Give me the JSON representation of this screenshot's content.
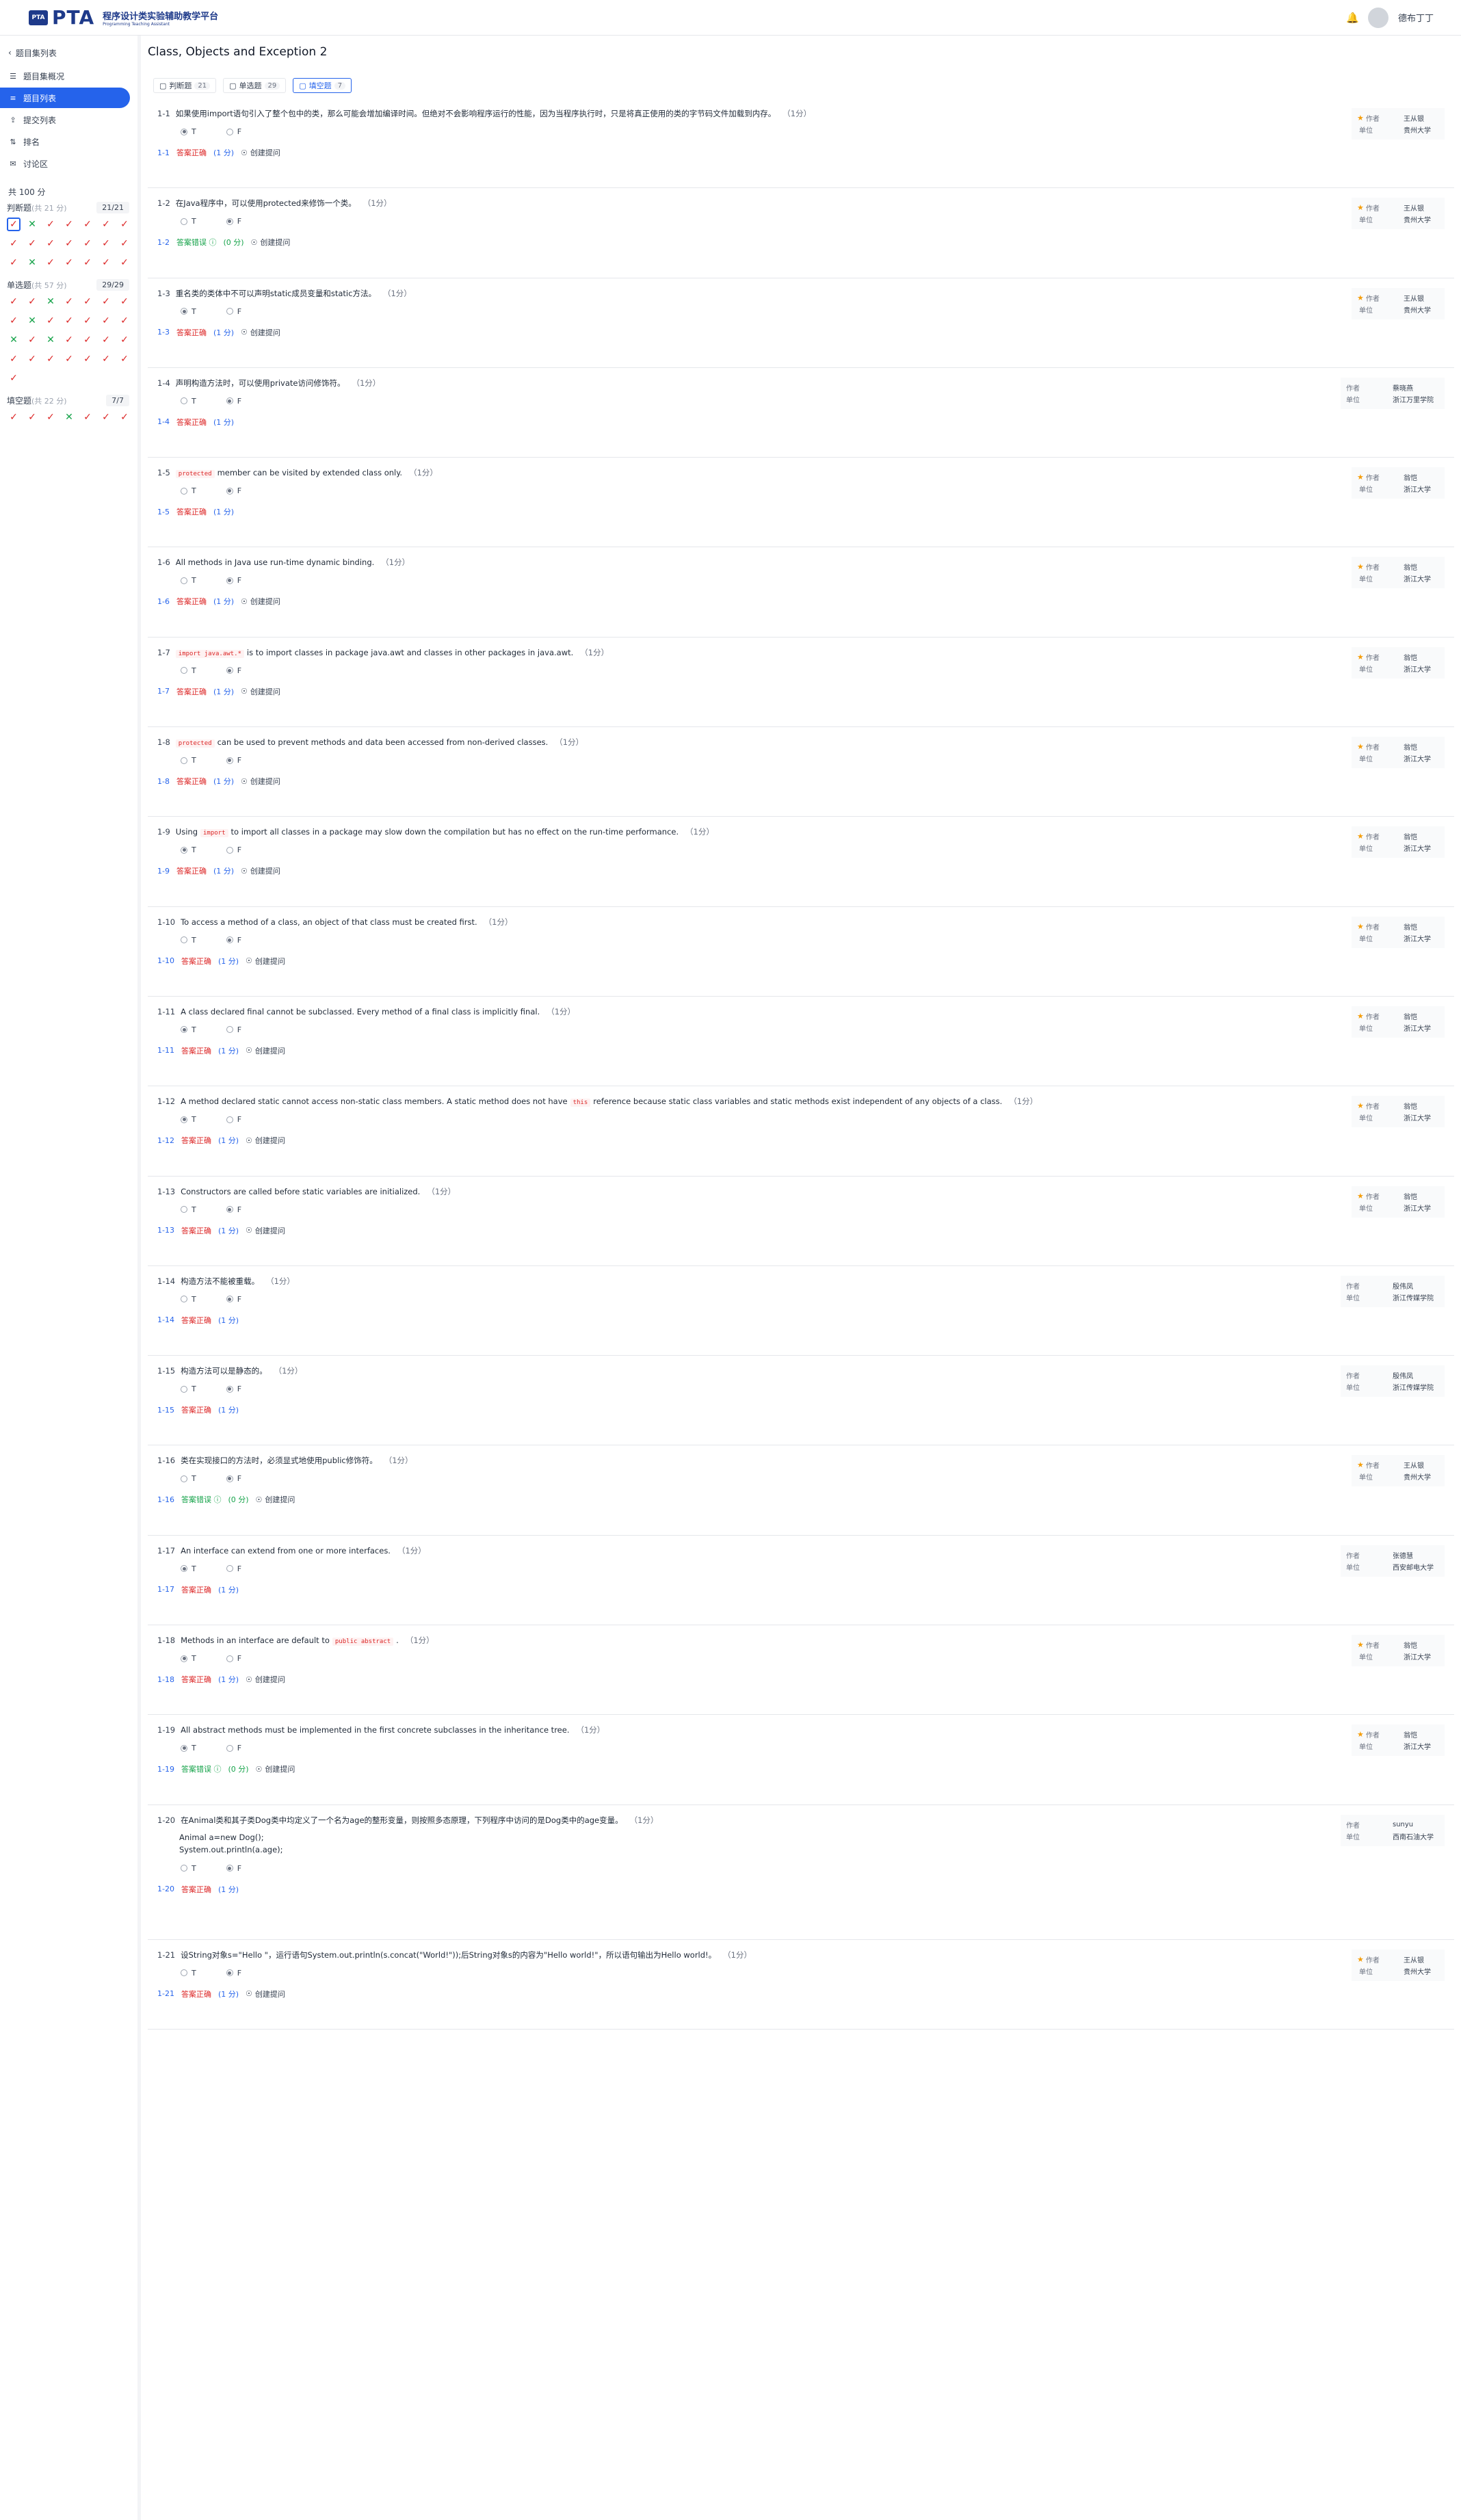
{
  "header": {
    "logo_badge": "PTA",
    "logo_text": "PTA",
    "platform_title": "程序设计类实验辅助教学平台",
    "platform_en": "Programming Teaching Assistant",
    "username": "德布丁丁"
  },
  "sidebar": {
    "back": "题目集列表",
    "nav": [
      {
        "label": "题目集概况",
        "icon": "book-icon"
      },
      {
        "label": "题目列表",
        "icon": "list-icon",
        "active": true
      },
      {
        "label": "提交列表",
        "icon": "upload-icon"
      },
      {
        "label": "排名",
        "icon": "sort-icon"
      },
      {
        "label": "讨论区",
        "icon": "chat-icon"
      }
    ],
    "total_score": "共 100 分",
    "sections": [
      {
        "name": "判断题",
        "sub": "(共 21 分)",
        "count": "21/21",
        "cells": [
          "c",
          "n",
          "o",
          "o",
          "o",
          "o",
          "o",
          "o",
          "o",
          "o",
          "o",
          "o",
          "o",
          "o",
          "o",
          "n",
          "o",
          "o",
          "o",
          "o",
          "o"
        ]
      },
      {
        "name": "单选题",
        "sub": "(共 57 分)",
        "count": "29/29",
        "cells": [
          "o",
          "o",
          "n",
          "o",
          "o",
          "o",
          "o",
          "o",
          "n",
          "o",
          "o",
          "o",
          "o",
          "o",
          "n",
          "o",
          "n",
          "o",
          "o",
          "o",
          "o",
          "o",
          "o",
          "o",
          "o",
          "o",
          "o",
          "o",
          "o"
        ]
      },
      {
        "name": "填空题",
        "sub": "(共 22 分)",
        "count": "7/7",
        "cells": [
          "o",
          "o",
          "o",
          "n",
          "o",
          "o",
          "o"
        ]
      }
    ]
  },
  "main": {
    "title": "Class, Objects and Exception 2",
    "tabs": [
      {
        "label": "判断题",
        "count": "21",
        "active": false
      },
      {
        "label": "单选题",
        "count": "29",
        "active": false
      },
      {
        "label": "填空题",
        "count": "7",
        "active": true
      }
    ],
    "author_label": "作者",
    "unit_label": "单位",
    "ask_label": "创建提问",
    "problems": [
      {
        "num": "1-1",
        "text": "如果使用import语句引入了整个包中的类，那么可能会增加编译时间。但绝对不会影响程序运行的性能，因为当程序执行时，只是将真正使用的类的字节码文件加载到内存。",
        "pts": "（1分）",
        "sel": "T",
        "status": "答案正确",
        "ok": false,
        "score": "(1 分)",
        "author": "王从银",
        "unit": "贵州大学",
        "ask": true
      },
      {
        "num": "1-2",
        "text": "在Java程序中，可以使用protected来修饰一个类。",
        "pts": "（1分）",
        "sel": "F",
        "status": "答案错误",
        "ok": true,
        "score": "(0 分)",
        "author": "王从银",
        "unit": "贵州大学",
        "ask": true
      },
      {
        "num": "1-3",
        "text": "重名类的类体中不可以声明static成员变量和static方法。",
        "pts": "（1分）",
        "sel": "T",
        "status": "答案正确",
        "ok": false,
        "score": "(1 分)",
        "author": "王从银",
        "unit": "贵州大学",
        "ask": true
      },
      {
        "num": "1-4",
        "text": "声明构造方法时，可以使用private访问修饰符。",
        "pts": "（1分）",
        "sel": "F",
        "status": "答案正确",
        "ok": false,
        "score": "(1 分)",
        "author": "蔡晓燕",
        "unit": "浙江万里学院",
        "ask": false,
        "wide": true
      },
      {
        "num": "1-5",
        "code": "protected",
        "text": "member can be visited by extended class only.",
        "pts": "（1分）",
        "sel": "F",
        "status": "答案正确",
        "ok": false,
        "score": "(1 分)",
        "author": "翁恺",
        "unit": "浙江大学",
        "ask": false
      },
      {
        "num": "1-6",
        "text": "All methods in Java use run-time dynamic binding.",
        "pts": "（1分）",
        "sel": "F",
        "status": "答案正确",
        "ok": false,
        "score": "(1 分)",
        "author": "翁恺",
        "unit": "浙江大学",
        "ask": true
      },
      {
        "num": "1-7",
        "code": "import java.awt.*",
        "text": "is to import classes in package java.awt and classes in other packages in java.awt.",
        "pts": "（1分）",
        "sel": "F",
        "status": "答案正确",
        "ok": false,
        "score": "(1 分)",
        "author": "翁恺",
        "unit": "浙江大学",
        "ask": true
      },
      {
        "num": "1-8",
        "code": "protected",
        "text": "can be used to prevent methods and data been accessed from non-derived classes.",
        "pts": "（1分）",
        "sel": "F",
        "status": "答案正确",
        "ok": false,
        "score": "(1 分)",
        "author": "翁恺",
        "unit": "浙江大学",
        "ask": true
      },
      {
        "num": "1-9",
        "pre": "Using",
        "code": "import",
        "text": "to import all classes in a package may slow down the compilation but has no effect on the run-time performance.",
        "pts": "（1分）",
        "sel": "T",
        "status": "答案正确",
        "ok": false,
        "score": "(1 分)",
        "author": "翁恺",
        "unit": "浙江大学",
        "ask": true
      },
      {
        "num": "1-10",
        "text": "To access a method of a class, an object of that class must be created first.",
        "pts": "（1分）",
        "sel": "F",
        "status": "答案正确",
        "ok": false,
        "score": "(1 分)",
        "author": "翁恺",
        "unit": "浙江大学",
        "ask": true
      },
      {
        "num": "1-11",
        "text": "A class declared final cannot be subclassed. Every method of a final class is implicitly final.",
        "pts": "（1分）",
        "sel": "T",
        "status": "答案正确",
        "ok": false,
        "score": "(1 分)",
        "author": "翁恺",
        "unit": "浙江大学",
        "ask": true
      },
      {
        "num": "1-12",
        "text": "A method declared static cannot access non-static class members. A static method does not have",
        "code2": "this",
        "text2": "reference because static class variables and static methods exist independent of any objects of a class.",
        "pts": "（1分）",
        "sel": "T",
        "status": "答案正确",
        "ok": false,
        "score": "(1 分)",
        "author": "翁恺",
        "unit": "浙江大学",
        "ask": true
      },
      {
        "num": "1-13",
        "text": "Constructors are called before static variables are initialized.",
        "pts": "（1分）",
        "sel": "F",
        "status": "答案正确",
        "ok": false,
        "score": "(1 分)",
        "author": "翁恺",
        "unit": "浙江大学",
        "ask": true
      },
      {
        "num": "1-14",
        "text": "构造方法不能被重载。",
        "pts": "（1分）",
        "sel": "F",
        "status": "答案正确",
        "ok": false,
        "score": "(1 分)",
        "author": "殷伟凤",
        "unit": "浙江传媒学院",
        "ask": false,
        "wide": true
      },
      {
        "num": "1-15",
        "text": "构造方法可以是静态的。",
        "pts": "（1分）",
        "sel": "F",
        "status": "答案正确",
        "ok": false,
        "score": "(1 分)",
        "author": "殷伟凤",
        "unit": "浙江传媒学院",
        "ask": false,
        "wide": true
      },
      {
        "num": "1-16",
        "text": "类在实现接口的方法时，必须显式地使用public修饰符。",
        "pts": "（1分）",
        "sel": "F",
        "status": "答案错误",
        "ok": true,
        "score": "(0 分)",
        "author": "王从银",
        "unit": "贵州大学",
        "ask": true
      },
      {
        "num": "1-17",
        "text": "An interface can extend from one or more interfaces.",
        "pts": "（1分）",
        "sel": "T",
        "status": "答案正确",
        "ok": false,
        "score": "(1 分)",
        "author": "张德慧",
        "unit": "西安邮电大学",
        "ask": false,
        "wide": true
      },
      {
        "num": "1-18",
        "pre": "Methods in an interface are default to",
        "code": "public abstract",
        "text": ".",
        "pts": "（1分）",
        "sel": "T",
        "status": "答案正确",
        "ok": false,
        "score": "(1 分)",
        "author": "翁恺",
        "unit": "浙江大学",
        "ask": true
      },
      {
        "num": "1-19",
        "text": "All abstract methods must be implemented in the first concrete subclasses in the inheritance tree.",
        "pts": "（1分）",
        "sel": "T",
        "status": "答案错误",
        "ok": true,
        "score": "(0 分)",
        "author": "翁恺",
        "unit": "浙江大学",
        "ask": true
      },
      {
        "num": "1-20",
        "text": "在Animal类和其子类Dog类中均定义了一个名为age的整形变量，则按照多态原理，下列程序中访问的是Dog类中的age变量。",
        "pts": "（1分）",
        "extra": [
          "Animal a=new Dog();",
          "System.out.println(a.age);"
        ],
        "sel": "F",
        "status": "答案正确",
        "ok": false,
        "score": "(1 分)",
        "author": "sunyu",
        "unit": "西南石油大学",
        "ask": false,
        "wide": true,
        "tall": true
      },
      {
        "num": "1-21",
        "text": "设String对象s=\"Hello \"，运行语句System.out.println(s.concat(\"World!\"));后String对象s的内容为\"Hello world!\"，所以语句输出为Hello world!。",
        "pts": "（1分）",
        "sel": "F",
        "status": "答案正确",
        "ok": false,
        "score": "(1 分)",
        "author": "王从银",
        "unit": "贵州大学",
        "ask": true
      }
    ]
  }
}
